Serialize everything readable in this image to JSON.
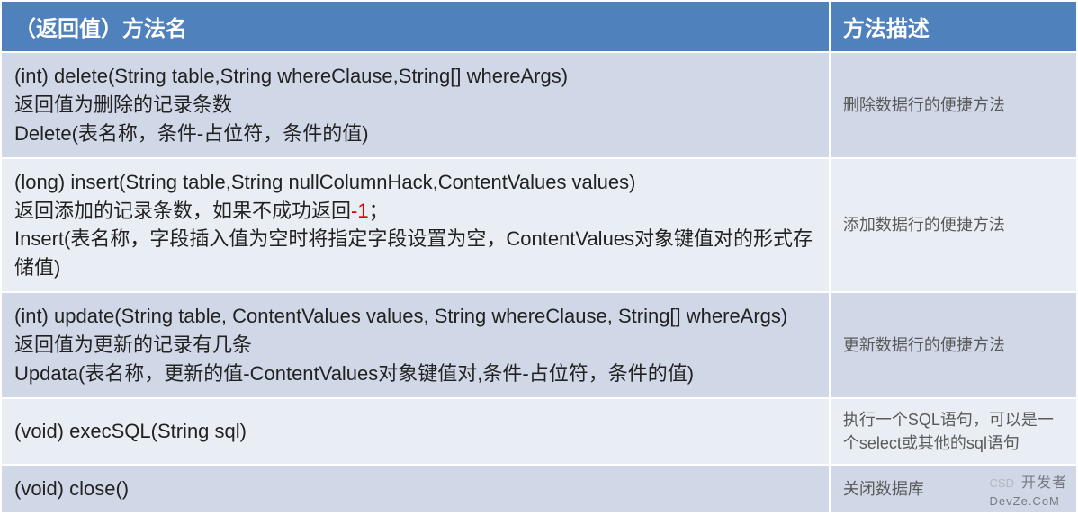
{
  "header": {
    "left": "（返回值）方法名",
    "right": "方法描述"
  },
  "rows": [
    {
      "left": [
        {
          "text": "(int) delete(String table,String whereClause,String[] whereArgs)"
        },
        {
          "text": "返回值为删除的记录条数"
        },
        {
          "text": "Delete(表名称，条件-占位符，条件的值)"
        }
      ],
      "right": "删除数据行的便捷方法"
    },
    {
      "left": [
        {
          "text": "(long) insert(String table,String nullColumnHack,ContentValues values)"
        },
        {
          "pre": "返回添加的记录条数，如果不成功返回",
          "hl": "-1",
          "post": "；"
        },
        {
          "text": "Insert(表名称，字段插入值为空时将指定字段设置为空，ContentValues对象键值对的形式存储值)"
        }
      ],
      "right": "添加数据行的便捷方法"
    },
    {
      "left": [
        {
          "text": "(int) update(String table, ContentValues values, String whereClause, String[] whereArgs)"
        },
        {
          "text": "返回值为更新的记录有几条"
        },
        {
          "text": "Updata(表名称，更新的值-ContentValues对象键值对,条件-占位符，条件的值)"
        }
      ],
      "right": "更新数据行的便捷方法"
    },
    {
      "left": [
        {
          "text": "(void) execSQL(String sql)"
        }
      ],
      "right": "执行一个SQL语句，可以是一个select或其他的sql语句"
    },
    {
      "left": [
        {
          "text": "(void) close()"
        }
      ],
      "right": "关闭数据库"
    }
  ],
  "watermark": {
    "csd": "CSD",
    "dev": "开发者",
    "com": "DevZe.CoM"
  }
}
